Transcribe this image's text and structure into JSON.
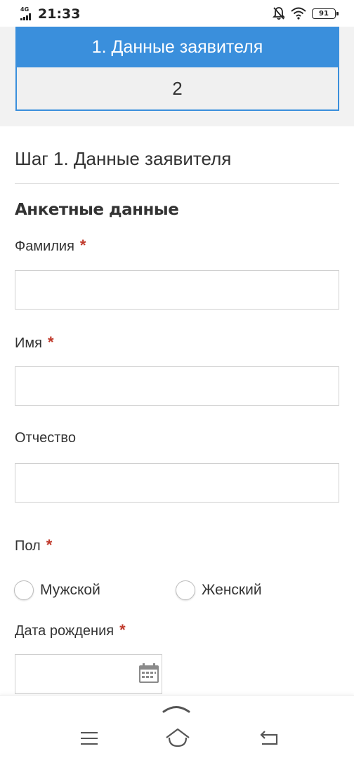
{
  "status_bar": {
    "network": "4G",
    "time": "21:33",
    "battery": "91",
    "icons": [
      "signal-icon",
      "bell-muted-icon",
      "wifi-icon",
      "battery-icon"
    ]
  },
  "stepper": {
    "active_step": "1. Данные заявителя",
    "next_step": "2"
  },
  "form": {
    "step_title": "Шаг 1. Данные заявителя",
    "section_title": "Анкетные данные",
    "required_mark": "*",
    "fields": {
      "surname": {
        "label": "Фамилия",
        "value": ""
      },
      "name": {
        "label": "Имя",
        "value": ""
      },
      "patronymic": {
        "label": "Отчество",
        "value": ""
      },
      "gender": {
        "label": "Пол",
        "options": [
          "Мужской",
          "Женский"
        ]
      },
      "birth_date": {
        "label": "Дата рождения",
        "value": ""
      }
    }
  },
  "colors": {
    "accent": "#3a8fdc",
    "required": "#c0392b",
    "stepper_bg": "#f2f2f2"
  },
  "navigation": {
    "icons": [
      "chevron-up-icon",
      "menu-icon",
      "home-icon",
      "back-icon"
    ]
  }
}
